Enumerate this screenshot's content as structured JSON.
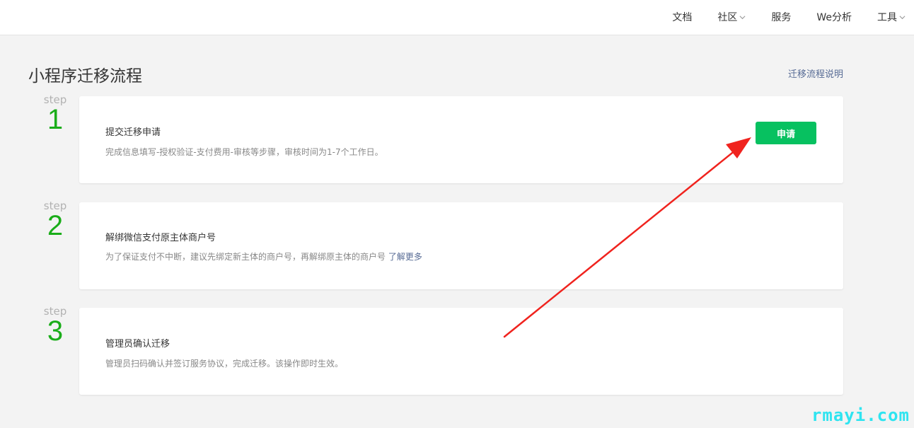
{
  "nav": {
    "items": [
      {
        "label": "文档",
        "has_dropdown": false
      },
      {
        "label": "社区",
        "has_dropdown": true
      },
      {
        "label": "服务",
        "has_dropdown": false
      },
      {
        "label": "We分析",
        "has_dropdown": false
      },
      {
        "label": "工具",
        "has_dropdown": true
      }
    ]
  },
  "page": {
    "title": "小程序迁移流程",
    "help_link": "迁移流程说明"
  },
  "steps": [
    {
      "word": "step",
      "number": "1",
      "title": "提交迁移申请",
      "desc": "完成信息填写-授权验证-支付费用-审核等步骤，审核时间为1-7个工作日。",
      "button": "申请"
    },
    {
      "word": "step",
      "number": "2",
      "title": "解绑微信支付原主体商户号",
      "desc": "为了保证支付不中断，建议先绑定新主体的商户号，再解绑原主体的商户号",
      "link": "了解更多"
    },
    {
      "word": "step",
      "number": "3",
      "title": "管理员确认迁移",
      "desc": "管理员扫码确认并签订服务协议，完成迁移。该操作即时生效。"
    }
  ],
  "watermark": "rmayi.com",
  "colors": {
    "accent_green": "#07c160",
    "step_green": "#1aad19",
    "link_blue": "#576b95",
    "arrow_red": "#f0231e",
    "watermark_cyan": "#2fe4f0"
  }
}
